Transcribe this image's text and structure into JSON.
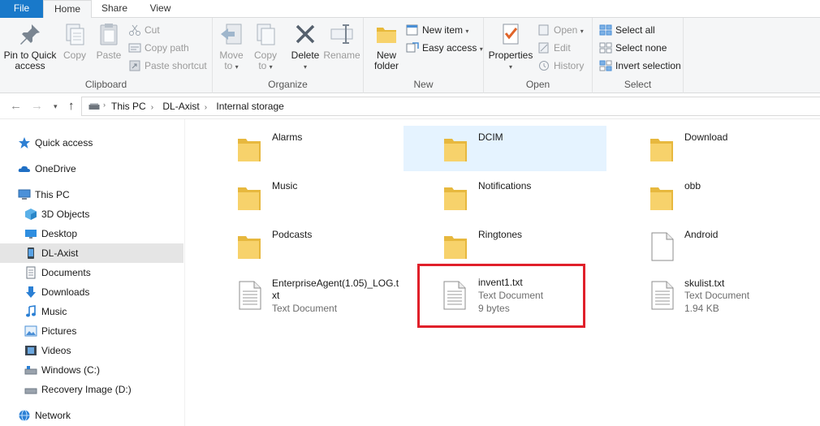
{
  "tabs": {
    "file": "File",
    "home": "Home",
    "share": "Share",
    "view": "View"
  },
  "ribbon": {
    "clipboard": {
      "label": "Clipboard",
      "pin_line1": "Pin to Quick",
      "pin_line2": "access",
      "copy": "Copy",
      "paste": "Paste",
      "cut": "Cut",
      "copy_path": "Copy path",
      "paste_shortcut": "Paste shortcut"
    },
    "organize": {
      "label": "Organize",
      "move_to_line1": "Move",
      "move_to_line2": "to",
      "copy_to_line1": "Copy",
      "copy_to_line2": "to",
      "delete": "Delete",
      "rename": "Rename"
    },
    "new": {
      "label": "New",
      "new_folder_line1": "New",
      "new_folder_line2": "folder",
      "new_item": "New item",
      "easy_access": "Easy access"
    },
    "open": {
      "label": "Open",
      "properties": "Properties",
      "open": "Open",
      "edit": "Edit",
      "history": "History"
    },
    "select": {
      "label": "Select",
      "select_all": "Select all",
      "select_none": "Select none",
      "invert_selection": "Invert selection"
    }
  },
  "address": {
    "crumbs": [
      "This PC",
      "DL-Axist",
      "Internal storage"
    ]
  },
  "sidebar": {
    "items": [
      {
        "label": "Quick access",
        "icon": "star-icon"
      },
      {
        "label": "OneDrive",
        "icon": "cloud-icon"
      },
      {
        "label": "This PC",
        "icon": "computer-icon"
      },
      {
        "label": "3D Objects",
        "icon": "cube-icon"
      },
      {
        "label": "Desktop",
        "icon": "desktop-icon"
      },
      {
        "label": "DL-Axist",
        "icon": "phone-icon"
      },
      {
        "label": "Documents",
        "icon": "document-icon"
      },
      {
        "label": "Downloads",
        "icon": "download-icon"
      },
      {
        "label": "Music",
        "icon": "music-icon"
      },
      {
        "label": "Pictures",
        "icon": "pictures-icon"
      },
      {
        "label": "Videos",
        "icon": "video-icon"
      },
      {
        "label": "Windows (C:)",
        "icon": "drive-icon"
      },
      {
        "label": "Recovery Image (D:)",
        "icon": "drive-icon"
      },
      {
        "label": "Network",
        "icon": "network-icon"
      }
    ]
  },
  "files": [
    {
      "name": "Alarms",
      "kind": "folder"
    },
    {
      "name": "DCIM",
      "kind": "folder"
    },
    {
      "name": "Download",
      "kind": "folder"
    },
    {
      "name": "Music",
      "kind": "folder"
    },
    {
      "name": "Notifications",
      "kind": "folder"
    },
    {
      "name": "obb",
      "kind": "folder"
    },
    {
      "name": "Podcasts",
      "kind": "folder"
    },
    {
      "name": "Ringtones",
      "kind": "folder"
    },
    {
      "name": "Android",
      "kind": "file"
    },
    {
      "name": "EnterpriseAgent(1.05)_LOG.txt",
      "kind": "text",
      "type": "Text Document"
    },
    {
      "name": "invent1.txt",
      "kind": "text",
      "type": "Text Document",
      "size": "9 bytes"
    },
    {
      "name": "skulist.txt",
      "kind": "text",
      "type": "Text Document",
      "size": "1.94 KB"
    }
  ],
  "colors": {
    "accent": "#1979ca",
    "highlight": "#e0202a",
    "folder": "#f7d26b",
    "selection": "#e5f3ff"
  }
}
